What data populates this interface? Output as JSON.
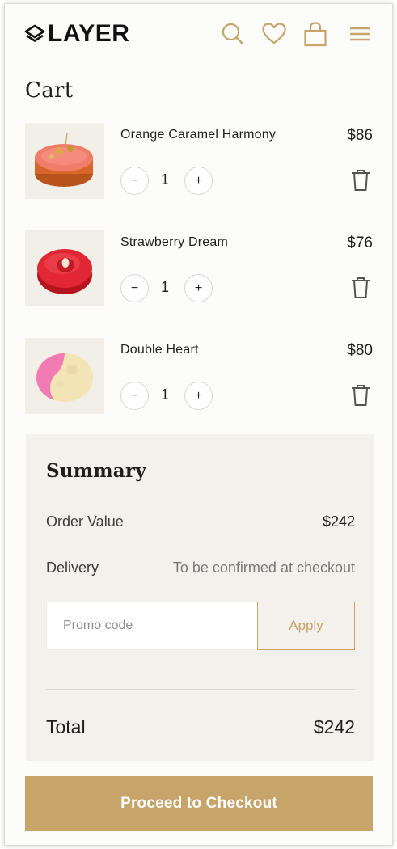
{
  "header": {
    "logo_text": "LAYER",
    "icons": [
      "search-icon",
      "heart-icon",
      "bag-icon",
      "menu-icon"
    ]
  },
  "cart": {
    "title": "Cart",
    "items": [
      {
        "name": "Orange Caramel Harmony",
        "price": "$86",
        "quantity": "1"
      },
      {
        "name": "Strawberry Dream",
        "price": "$76",
        "quantity": "1"
      },
      {
        "name": "Double Heart",
        "price": "$80",
        "quantity": "1"
      }
    ],
    "minus_symbol": "−",
    "plus_symbol": "+"
  },
  "summary": {
    "title": "Summary",
    "order_value_label": "Order Value",
    "order_value": "$242",
    "delivery_label": "Delivery",
    "delivery_value": "To be confirmed at checkout",
    "promo_placeholder": "Promo code",
    "apply_label": "Apply",
    "total_label": "Total",
    "total_value": "$242"
  },
  "checkout_label": "Proceed to Checkout",
  "colors": {
    "accent": "#c6a46a",
    "summary_bg": "#f4f1ec",
    "thumb_bg": "#f2eee8"
  }
}
